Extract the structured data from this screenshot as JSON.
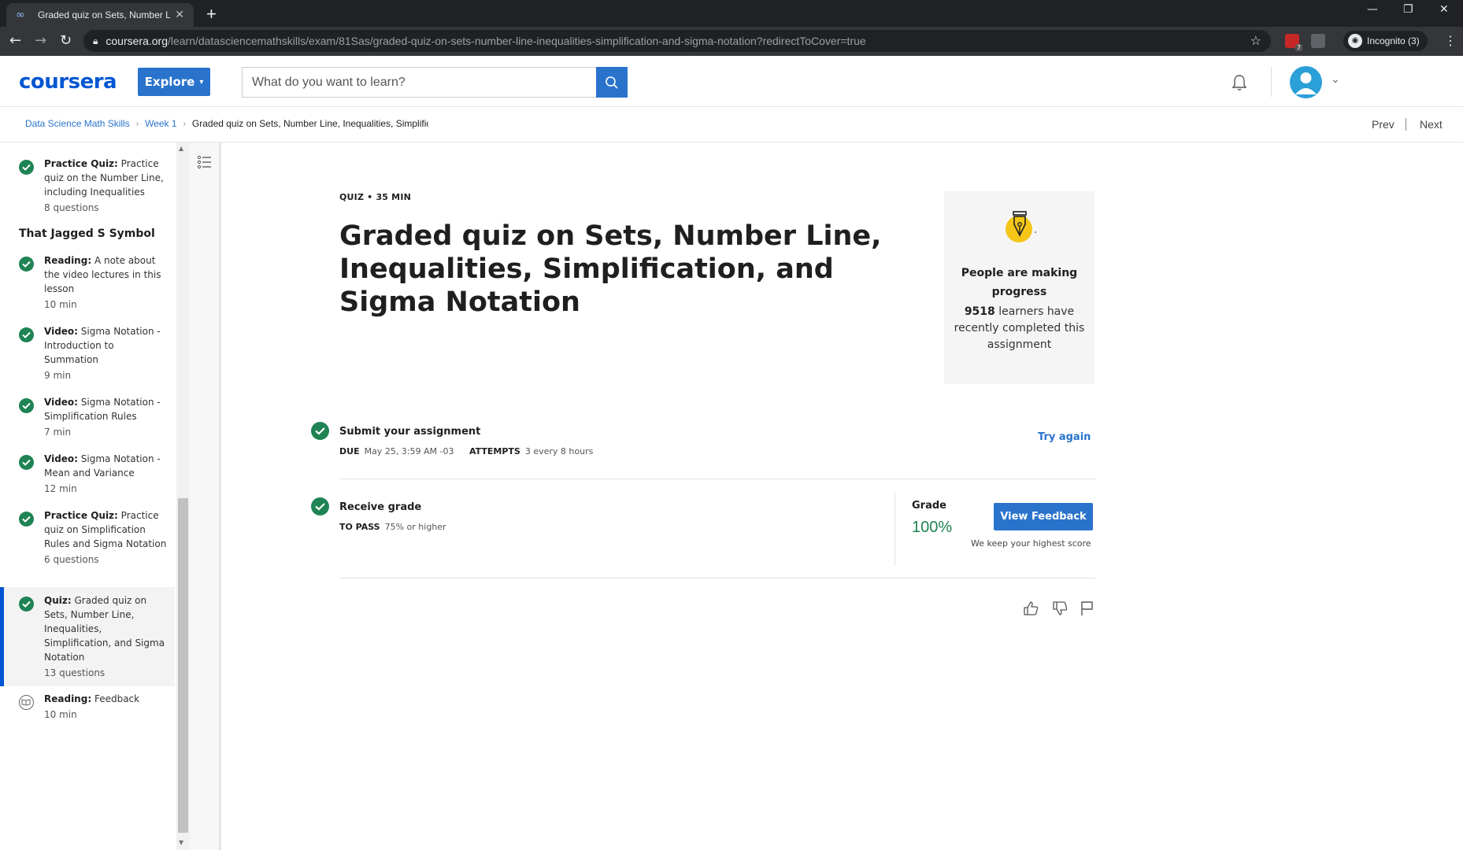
{
  "browser": {
    "tab_title": "Graded quiz on Sets, Number Line, Inequalities, Simplification, and Sigma Notation",
    "url_host": "coursera.org",
    "url_path": "/learn/datasciencemathskills/exam/81Sas/graded-quiz-on-sets-number-line-inequalities-simplification-and-sigma-notation?redirectToCover=true",
    "incognito_label": "Incognito (3)",
    "ext_badge": "7"
  },
  "header": {
    "logo": "coursera",
    "explore_label": "Explore",
    "search_placeholder": "What do you want to learn?"
  },
  "breadcrumb": {
    "items": [
      "Data Science Math Skills",
      "Week 1"
    ],
    "current": "Graded quiz on Sets, Number Line, Inequalities, Simplification, and Sigma Notation",
    "prev": "Prev",
    "next": "Next"
  },
  "sidebar": {
    "section_title": "That Jagged S Symbol",
    "items": [
      {
        "kind": "Practice Quiz:",
        "title": "Practice quiz on the Number Line, including Inequalities",
        "meta": "8 questions"
      },
      {
        "kind": "Reading:",
        "title": "A note about the video lectures in this lesson",
        "meta": "10 min"
      },
      {
        "kind": "Video:",
        "title": "Sigma Notation - Introduction to Summation",
        "meta": "9 min"
      },
      {
        "kind": "Video:",
        "title": "Sigma Notation - Simplification Rules",
        "meta": "7 min"
      },
      {
        "kind": "Video:",
        "title": "Sigma Notation - Mean and Variance",
        "meta": "12 min"
      },
      {
        "kind": "Practice Quiz:",
        "title": "Practice quiz on Simplification Rules and Sigma Notation",
        "meta": "6 questions"
      },
      {
        "kind": "Quiz:",
        "title": "Graded quiz on Sets, Number Line, Inequalities, Simplification, and Sigma Notation",
        "meta": "13 questions"
      },
      {
        "kind": "Reading:",
        "title": "Feedback",
        "meta": "10 min"
      }
    ]
  },
  "main": {
    "meta": "QUIZ • 35 MIN",
    "title": "Graded quiz on Sets, Number Line, Inequalities, Simplification, and Sigma Notation",
    "progress_card": {
      "title": "People are making progress",
      "count": "9518",
      "body": "learners have recently completed this assignment"
    },
    "submit": {
      "title": "Submit your assignment",
      "due_label": "DUE",
      "due_value": "May 25, 3:59 AM -03",
      "attempts_label": "ATTEMPTS",
      "attempts_value": "3 every 8 hours",
      "try_again": "Try again"
    },
    "receive": {
      "title": "Receive grade",
      "pass_label": "TO PASS",
      "pass_value": "75% or higher",
      "grade_label": "Grade",
      "grade_value": "100%",
      "feedback_button": "View Feedback",
      "highest_note": "We keep your highest score"
    }
  },
  "colors": {
    "brand": "#0056d2",
    "button_blue": "#2a73cc",
    "complete_green": "#1f8354"
  }
}
